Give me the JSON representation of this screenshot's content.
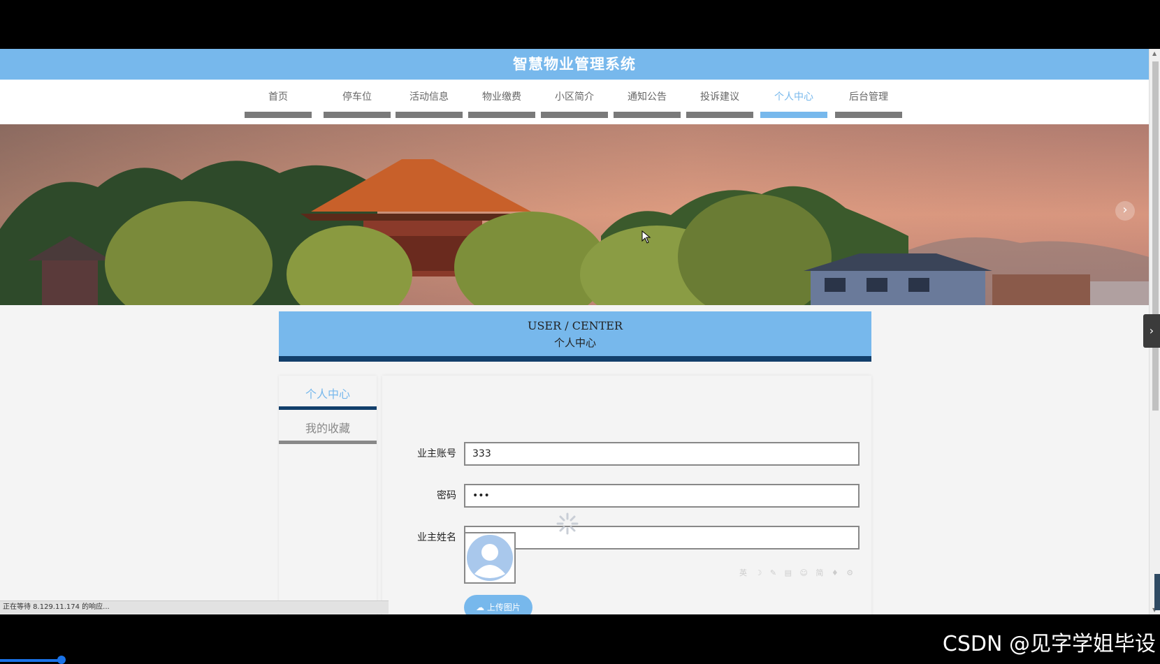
{
  "site_title": "智慧物业管理系统",
  "nav": {
    "items": [
      {
        "label": "首页"
      },
      {
        "label": "停车位"
      },
      {
        "label": "活动信息"
      },
      {
        "label": "物业缴费"
      },
      {
        "label": "小区简介"
      },
      {
        "label": "通知公告"
      },
      {
        "label": "投诉建议"
      },
      {
        "label": "个人中心",
        "active": true
      },
      {
        "label": "后台管理"
      }
    ]
  },
  "banner": {
    "next_icon": "chevron-right-icon",
    "next_glyph": "›"
  },
  "user_center": {
    "title_en": "USER / CENTER",
    "title_zh": "个人中心"
  },
  "sidebar": {
    "items": [
      {
        "label": "个人中心",
        "active": true
      },
      {
        "label": "我的收藏"
      }
    ]
  },
  "form": {
    "account": {
      "label": "业主账号",
      "value": "333"
    },
    "password": {
      "label": "密码",
      "value": "•••"
    },
    "name": {
      "label": "业主姓名",
      "placeholder": "业主姓名"
    },
    "upload_label": "上传图片"
  },
  "status_text": "正在等待 8.129.11.174 的响应...",
  "ime_toolbar": "英 ☽ ✎ ▤ ☺ 简 ♦ ⚙",
  "side_toggle_glyph": "›",
  "watermark": "CSDN @见字学姐毕设",
  "colors": {
    "accent": "#77b8ec",
    "dark_accent": "#123f6b",
    "nav_bar": "#7a7a7a"
  }
}
